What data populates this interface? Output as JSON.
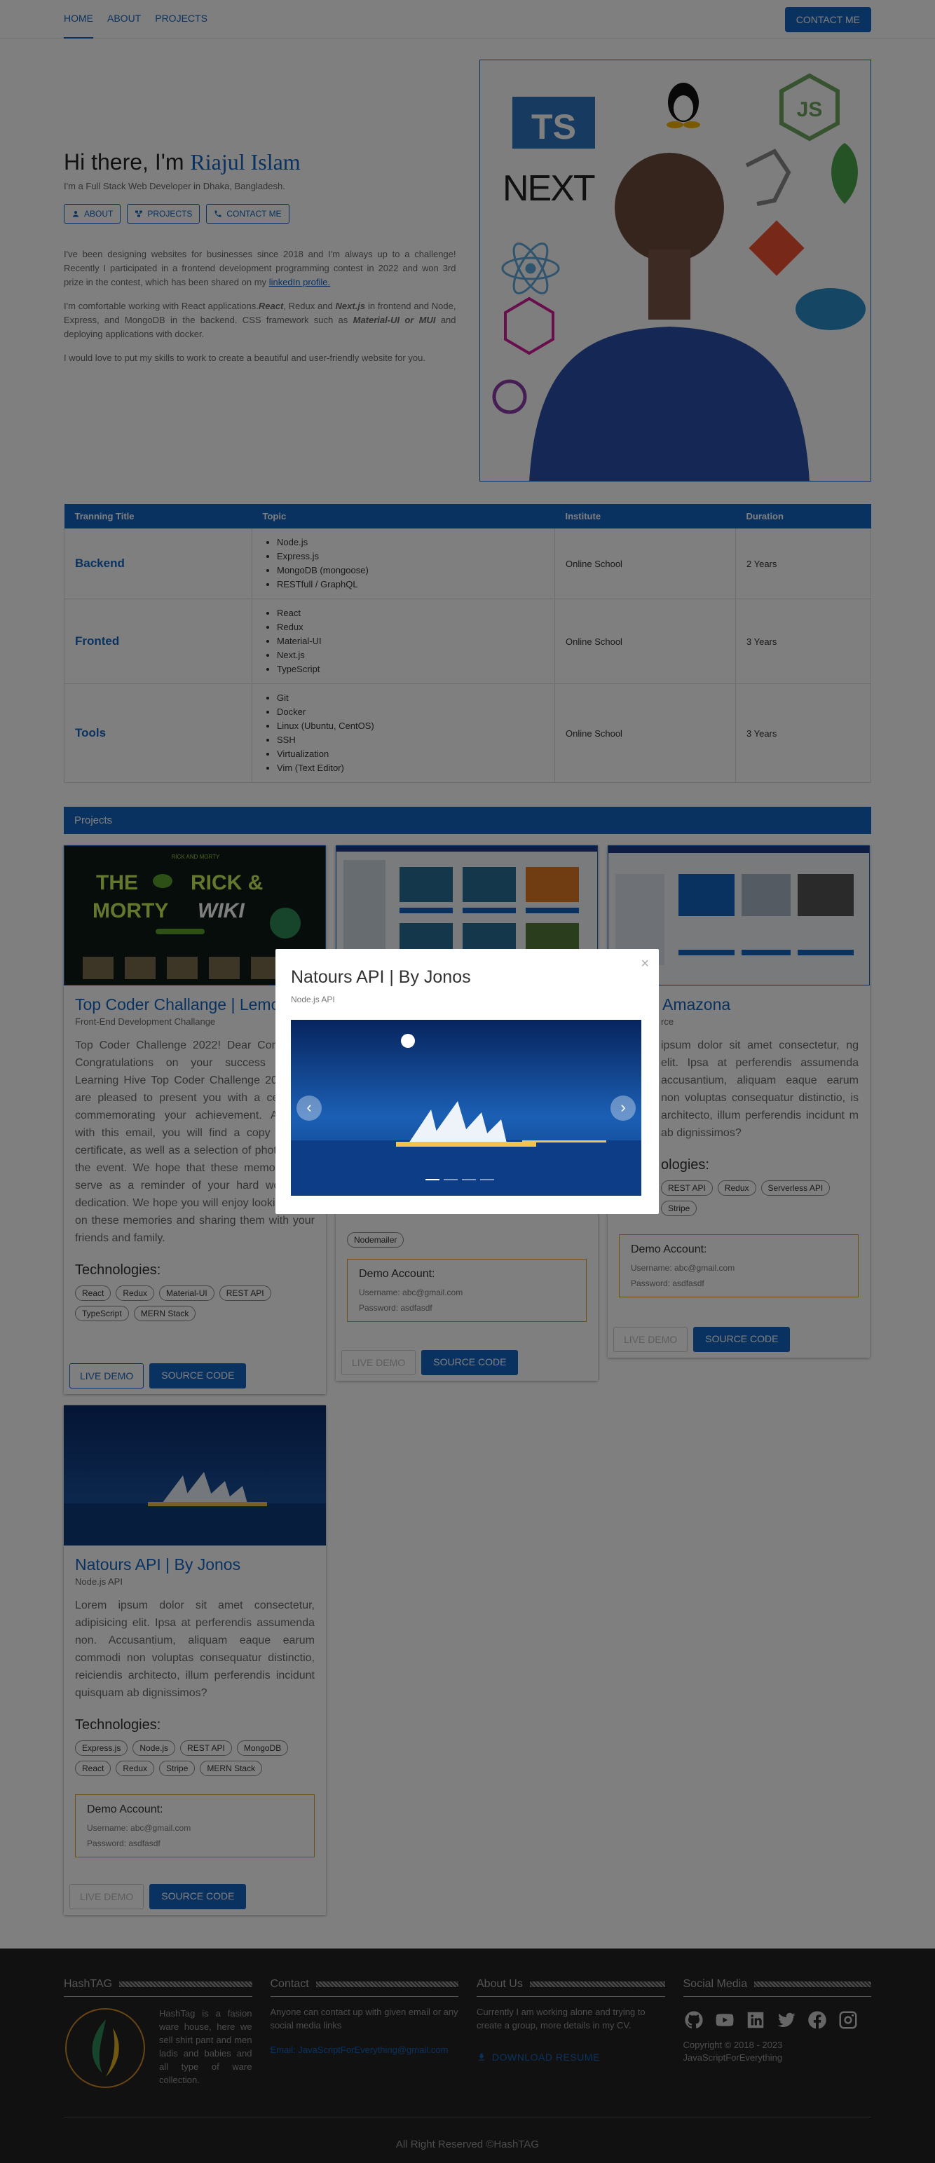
{
  "nav": {
    "links": [
      "HOME",
      "ABOUT",
      "PROJECTS"
    ],
    "cta": "CONTACT ME"
  },
  "hero": {
    "greeting": "Hi there, I'm",
    "name": "Riajul Islam",
    "subtitle": "I'm a Full Stack Web Developer in Dhaka, Bangladesh.",
    "buttons": [
      "ABOUT",
      "PROJECTS",
      "CONTACT ME"
    ],
    "p1_before": "I've been designing websites for businesses since 2018 and I'm always up to a challenge! Recently I participated in a frontend development programming contest in 2022 and won 3rd prize in the contest, which has been shared on my",
    "p1_link": "linkedIn profile.",
    "p2_a": "I'm comfortable working with React applications.",
    "p2_react": "React",
    "p2_b": ", Redux and",
    "p2_next": "Next.js",
    "p2_c": "in frontend and Node, Express, and MongoDB in the backend. CSS framework such as",
    "p2_mui": "Material-UI or MUI",
    "p2_d": "and deploying applications with docker.",
    "p3": "I would love to put my skills to work to create a beautiful and user-friendly website for you.",
    "logo_next": "NEXT",
    "logo_js": "JS",
    "logo_ts": "TS"
  },
  "training": {
    "headers": [
      "Tranning Title",
      "Topic",
      "Institute",
      "Duration"
    ],
    "rows": [
      {
        "title": "Backend",
        "topics": [
          "Node.js",
          "Express.js",
          "MongoDB (mongoose)",
          "RESTfull / GraphQL"
        ],
        "institute": "Online School",
        "duration": "2 Years"
      },
      {
        "title": "Fronted",
        "topics": [
          "React",
          "Redux",
          "Material-UI",
          "Next.js",
          "TypeScript"
        ],
        "institute": "Online School",
        "duration": "3 Years"
      },
      {
        "title": "Tools",
        "topics": [
          "Git",
          "Docker",
          "Linux (Ubuntu, CentOS)",
          "SSH",
          "Virtualization",
          "Vim (Text Editor)"
        ],
        "institute": "Online School",
        "duration": "3 Years"
      }
    ]
  },
  "projects_bar": "Projects",
  "projects": [
    {
      "title": "Top Coder Challange | Lemon",
      "subtitle": "Front-End Development Challange",
      "description": "Top Coder Challenge 2022! Dear Contestant, Congratulations on your success in the Learning Hive Top Coder Challenge 2022! We are pleased to present you with a certificate commemorating your achievement. Attached with this email, you will find a copy of your certificate, as well as a selection of photos from the event. We hope that these memories will serve as a reminder of your hard work and dedication. We hope you will enjoy looking back on these memories and sharing them with your friends and family.",
      "tech_label": "Technologies:",
      "tech": [
        "React",
        "Redux",
        "Material-UI",
        "REST API",
        "TypeScript",
        "MERN Stack"
      ],
      "live": "LIVE DEMO",
      "source": "SOURCE CODE",
      "image_text": {
        "top": "RICK AND MORTY",
        "l1": "THE",
        "l2": "RICK &",
        "l3": "MORTY",
        "l4": "WIKI"
      }
    },
    {
      "tech_chip": "Nodemailer",
      "demo_title": "Demo Account:",
      "demo_user": "Username: abc@gmail.com",
      "demo_pass": "Password: asdfasdf",
      "live": "LIVE DEMO",
      "source": "SOURCE CODE"
    },
    {
      "title": "Amazona",
      "subtitle": "rce",
      "description": "ipsum dolor sit amet consectetur, ng elit. Ipsa at perferendis assumenda accusantium, aliquam eaque earum non voluptas consequatur distinctio, is architecto, illum perferendis incidunt m ab dignissimos?",
      "tech_label": "ologies:",
      "tech": [
        "REST API",
        "Redux",
        "Serverless API",
        "Stripe"
      ],
      "demo_title": "Demo Account:",
      "demo_user": "Username: abc@gmail.com",
      "demo_pass": "Password: asdfasdf",
      "live": "LIVE DEMO",
      "source": "SOURCE CODE"
    },
    {
      "title": "Natours API | By Jonos",
      "subtitle": "Node.js API",
      "description": "Lorem ipsum dolor sit amet consectetur, adipisicing elit. Ipsa at perferendis assumenda non. Accusantium, aliquam eaque earum commodi non voluptas consequatur distinctio, reiciendis architecto, illum perferendis incidunt quisquam ab dignissimos?",
      "tech_label": "Technologies:",
      "tech": [
        "Express.js",
        "Node.js",
        "REST API",
        "MongoDB",
        "React",
        "Redux",
        "Stripe",
        "MERN Stack"
      ],
      "demo_title": "Demo Account:",
      "demo_user": "Username: abc@gmail.com",
      "demo_pass": "Password: asdfasdf",
      "live": "LIVE DEMO",
      "source": "SOURCE CODE"
    }
  ],
  "footer": {
    "col1_head": "HashTAG",
    "col1_text": "HashTag is a fasion ware house, here we sell shirt pant and men ladis and babies and all type of ware collection.",
    "col2_head": "Contact",
    "col2_text": "Anyone can contact up with given email or any social media links",
    "col2_email": "Email: JavaScriptForEverything@gmail.com",
    "col3_head": "About Us",
    "col3_text": "Currently I am working alone and trying to create a group, more details in my CV.",
    "col3_resume": "DOWNLOAD RESUME",
    "col4_head": "Social Media",
    "copy1": "Copyright © 2018 - 2023",
    "copy2": "JavaScriptForEverything",
    "bottom": "All Right Reserved ©HashTAG"
  },
  "modal": {
    "close": "×",
    "title": "Natours API | By Jonos",
    "subtitle": "Node.js API",
    "prev": "‹",
    "next": "›"
  },
  "colors": {
    "primary": "#1565c0",
    "footer": "#222222",
    "overlay": "rgba(0,0,0,0.5)",
    "demo_border": "#e0a020"
  },
  "icons": [
    "person-icon",
    "projects-icon",
    "phone-icon",
    "github-icon",
    "youtube-icon",
    "linkedin-icon",
    "twitter-icon",
    "facebook-icon",
    "instagram-icon",
    "download-icon"
  ]
}
